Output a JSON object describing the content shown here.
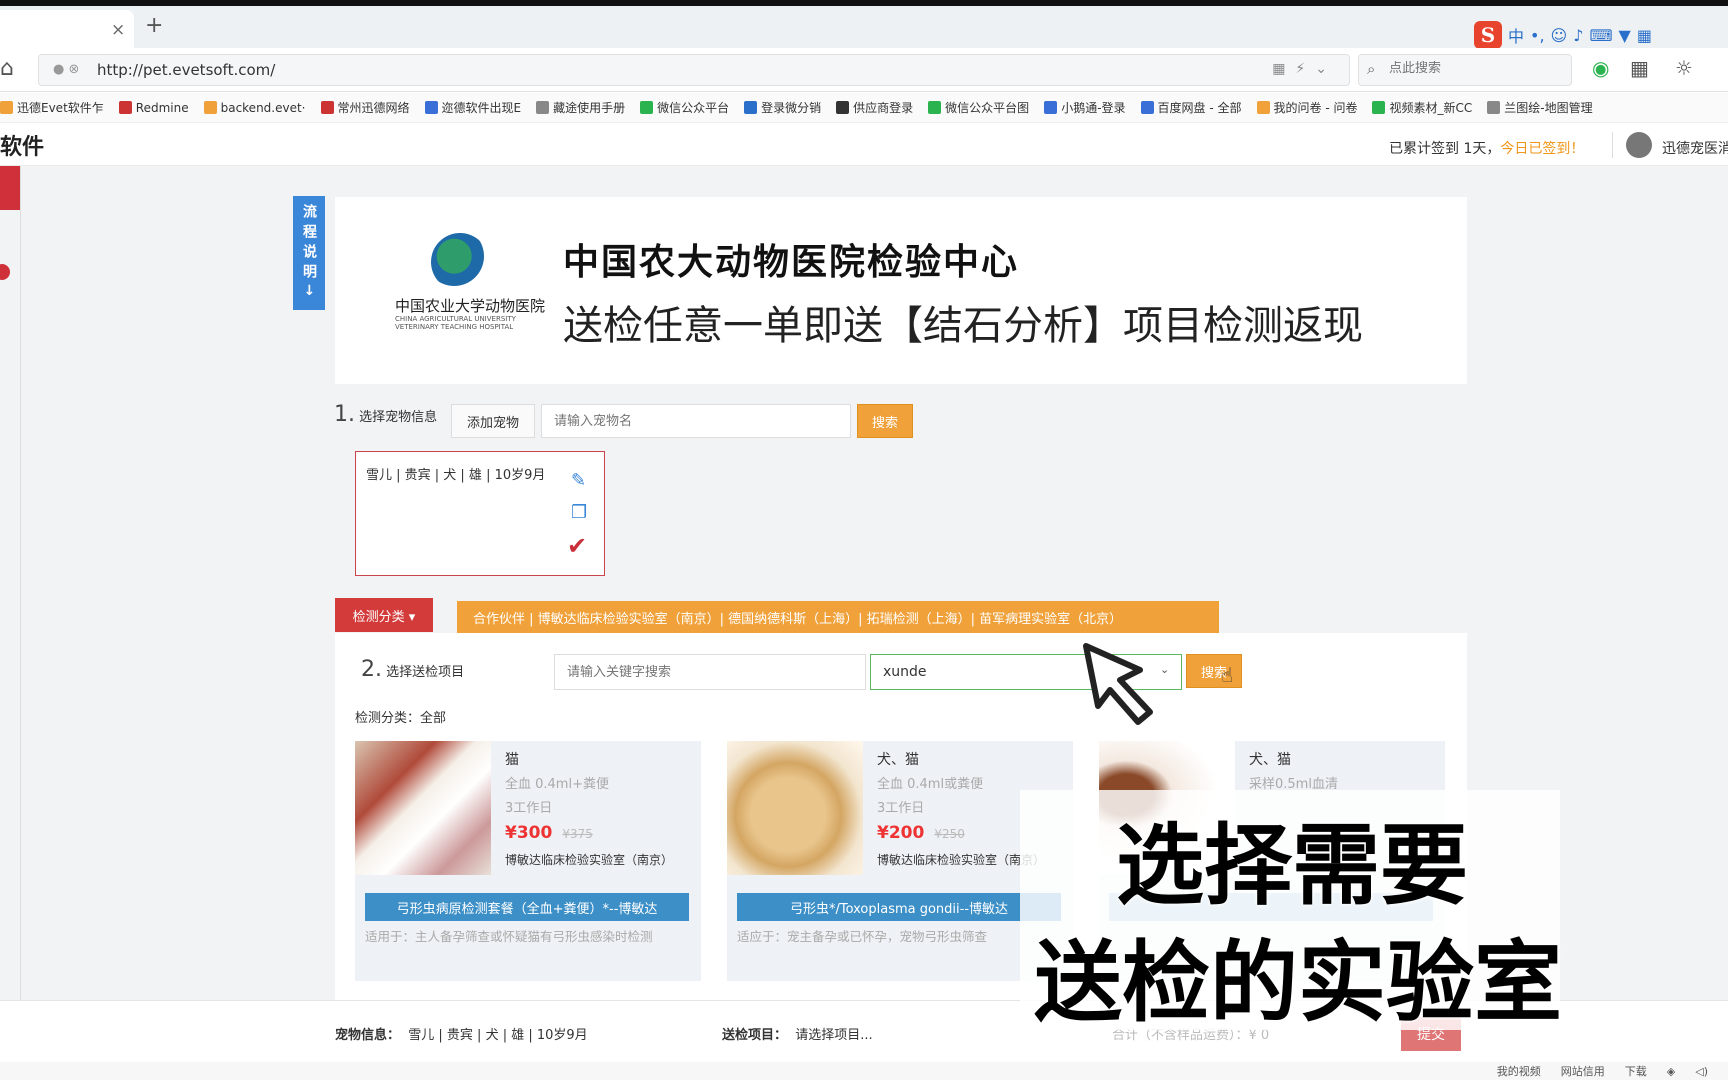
{
  "browser": {
    "url": "http://pet.evetsoft.com/",
    "search_placeholder": "点此搜索"
  },
  "bookmarks": [
    {
      "label": "迅德Evet软件乍",
      "color": "#f0a13a"
    },
    {
      "label": "Redmine",
      "color": "#c33"
    },
    {
      "label": "backend.evet·",
      "color": "#f0a13a"
    },
    {
      "label": "常州迅德网络",
      "color": "#c33"
    },
    {
      "label": "迩德软件出现E",
      "color": "#3a6fd8"
    },
    {
      "label": "藏途使用手册",
      "color": "#888"
    },
    {
      "label": "微信公众平台",
      "color": "#2ab34f"
    },
    {
      "label": "登录微分销",
      "color": "#2a6fc9"
    },
    {
      "label": "供应商登录",
      "color": "#333"
    },
    {
      "label": "微信公众平台图",
      "color": "#2ab34f"
    },
    {
      "label": "小鹅通-登录",
      "color": "#3a6fd8"
    },
    {
      "label": "百度网盘 - 全部",
      "color": "#3a6fd8"
    },
    {
      "label": "我的问卷 - 问卷",
      "color": "#f0a13a"
    },
    {
      "label": "视频素材_新CC",
      "color": "#2ab34f"
    },
    {
      "label": "兰图绘-地图管理",
      "color": "#888"
    }
  ],
  "header": {
    "brand": "软件",
    "sign_prefix": "已累计签到 1天，",
    "sign_today": "今日已签到！",
    "username": "迅德宠医消"
  },
  "flow_label": "流程说明→",
  "banner": {
    "logo_cn": "中国农业大学动物医院",
    "logo_en1": "CHINA AGRICULTURAL UNIVERSITY",
    "logo_en2": "VETERINARY TEACHING HOSPITAL",
    "title": "中国农大动物医院检验中心",
    "subtitle": "送检任意一单即送【结石分析】项目检测返现"
  },
  "step1": {
    "num": "1.",
    "label": "选择宠物信息",
    "add_pet": "添加宠物",
    "placeholder": "请输入宠物名",
    "search": "搜索"
  },
  "pet_card": {
    "text": "雪儿 | 贵宾 | 犬 | 雄 | 10岁9月"
  },
  "category_button": "检测分类 ▾",
  "partners_text": "合作伙伴 | 博敏达临床检验实验室（南京）| 德国纳德科斯（上海）| 拓瑞检测（上海）| 苗军病理实验室（北京）",
  "step2": {
    "num": "2.",
    "label": "选择送检项目",
    "keyword_placeholder": "请输入关键字搜索",
    "lab_value": "xunde",
    "search": "搜索",
    "category_line": "检测分类：全部"
  },
  "products": [
    {
      "species": "猫",
      "sample": "全血 0.4ml+粪便",
      "days": "3工作日",
      "price": "¥300",
      "old_price": "¥375",
      "lab": "博敏达临床检验实验室（南京）",
      "title": "弓形虫病原检测套餐（全血+粪便）*--博敏达",
      "desc": "适用于：主人备孕筛查或怀疑猫有弓形虫感染时检测"
    },
    {
      "species": "犬、猫",
      "sample": "全血 0.4ml或粪便",
      "days": "3工作日",
      "price": "¥200",
      "old_price": "¥250",
      "lab": "博敏达临床检验实验室（南京）",
      "title": "弓形虫*/Toxoplasma gondii--博敏达",
      "desc": "适应于：宠主备孕或已怀孕，宠物弓形虫筛查"
    },
    {
      "species": "犬、猫",
      "sample": "采样0.5ml血清",
      "days": "",
      "price": "",
      "old_price": "",
      "lab": "",
      "title": "",
      "desc": ""
    }
  ],
  "bottom": {
    "pet_label": "宠物信息：",
    "pet_value": "雪儿 | 贵宾 | 犬 | 雄 | 10岁9月",
    "item_label": "送检项目：",
    "item_value": "请选择项目...",
    "total": "合计（不含样品运费）：¥ 0",
    "submit": "提交"
  },
  "statusbar": [
    "我的视频",
    "网站信用",
    "下载"
  ],
  "overlay": {
    "line1": "选择需要",
    "line2": "送检的实验室"
  }
}
